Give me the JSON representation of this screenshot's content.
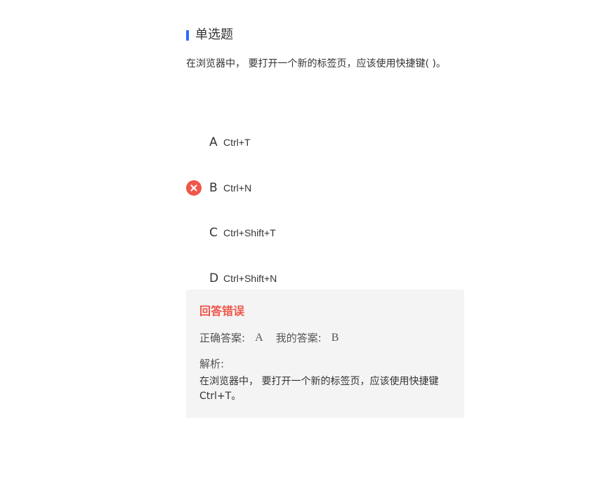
{
  "question": {
    "type_label": "单选题",
    "stem": "在浏览器中， 要打开一个新的标签页，应该使用快捷键( )。",
    "options": [
      {
        "letter": "A",
        "text": "Ctrl+T",
        "status": "none"
      },
      {
        "letter": "B",
        "text": "Ctrl+N",
        "status": "wrong"
      },
      {
        "letter": "C",
        "text": "Ctrl+Shift+T",
        "status": "none"
      },
      {
        "letter": "D",
        "text": "Ctrl+Shift+N",
        "status": "none"
      }
    ]
  },
  "result": {
    "title": "回答错误",
    "correct_label": "正确答案:",
    "correct_value": "A",
    "my_label": "我的答案:",
    "my_value": "B",
    "analysis_label": "解析:",
    "analysis_text": "在浏览器中， 要打开一个新的标签页，应该使用快捷键Ctrl+T。"
  },
  "colors": {
    "accent": "#2f6bff",
    "error": "#f0564a",
    "panel_bg": "#f4f4f4"
  },
  "icons": {
    "wrong_mark": "close-circle-icon"
  }
}
